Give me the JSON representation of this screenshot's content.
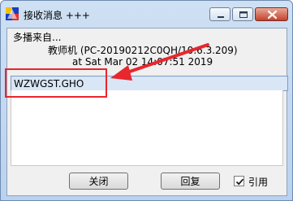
{
  "window": {
    "title": "接收消息 +++",
    "icon": "app-logo-icon",
    "controls": [
      "minimize-icon",
      "maximize-icon",
      "close-icon"
    ]
  },
  "message": {
    "sender": "多播来自...",
    "machine": "教师机 (PC-20190212C0QH/10.6.3.209)",
    "datetime": "at Sat Mar 02 14:07:51 2019",
    "content": "WZWGST.GHO"
  },
  "buttons": {
    "close": "关闭",
    "reply": "回复"
  },
  "quote": {
    "label": "引用",
    "checked": true
  },
  "colors": {
    "annotation": "#e8262d"
  }
}
